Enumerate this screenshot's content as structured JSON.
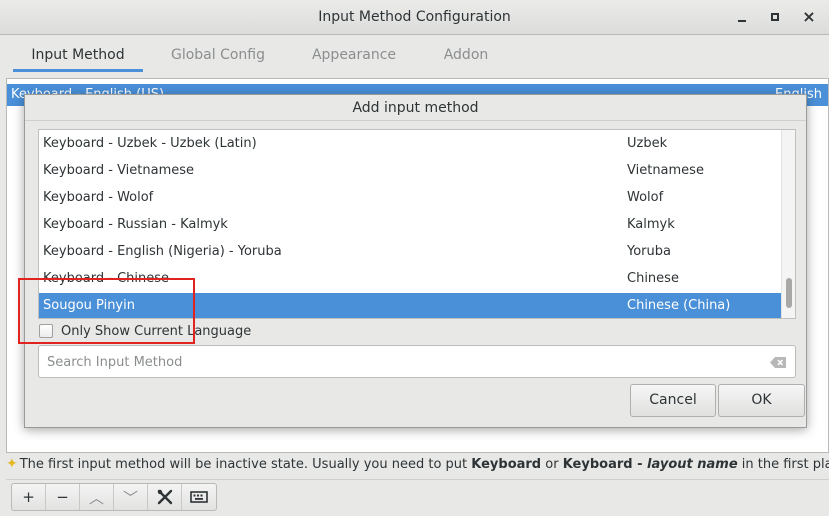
{
  "window": {
    "title": "Input Method Configuration",
    "controls": {
      "minimize": "minimize",
      "maximize": "maximize",
      "close": "×"
    }
  },
  "tabs": [
    {
      "label": "Input Method",
      "active": true
    },
    {
      "label": "Global Config",
      "active": false
    },
    {
      "label": "Appearance",
      "active": false
    },
    {
      "label": "Addon",
      "active": false
    }
  ],
  "main_list": {
    "selected_row": {
      "name": "Keyboard - English (US)",
      "language": "English"
    }
  },
  "hint": {
    "prefix": "The first input method will be inactive state. Usually you need to put ",
    "bold1": "Keyboard",
    "mid": " or ",
    "bold2": "Keyboard - ",
    "italic": "layout name",
    "suffix": " in the first place."
  },
  "toolbar": {
    "add": "+",
    "remove": "−",
    "up": "︿",
    "down": "﹀",
    "configure_icon": "tools-icon",
    "keyboard_icon": "keyboard-icon"
  },
  "dialog": {
    "title": "Add input method",
    "rows": [
      {
        "name": "Keyboard - Uzbek - Uzbek (Latin)",
        "language": "Uzbek",
        "selected": false
      },
      {
        "name": "Keyboard - Vietnamese",
        "language": "Vietnamese",
        "selected": false
      },
      {
        "name": "Keyboard - Wolof",
        "language": "Wolof",
        "selected": false
      },
      {
        "name": "Keyboard - Russian - Kalmyk",
        "language": "Kalmyk",
        "selected": false
      },
      {
        "name": "Keyboard - English (Nigeria) - Yoruba",
        "language": "Yoruba",
        "selected": false
      },
      {
        "name": "Keyboard - Chinese",
        "language": "Chinese",
        "selected": false
      },
      {
        "name": "Sougou Pinyin",
        "language": "Chinese (China)",
        "selected": true
      }
    ],
    "only_show_current_language": {
      "label": "Only Show Current Language",
      "checked": false
    },
    "search": {
      "placeholder": "Search Input Method",
      "value": ""
    },
    "cancel_label": "Cancel",
    "ok_label": "OK"
  },
  "colors": {
    "accent": "#4a90d9",
    "annotation": "#e0231e",
    "hint_star": "#e5b820"
  }
}
